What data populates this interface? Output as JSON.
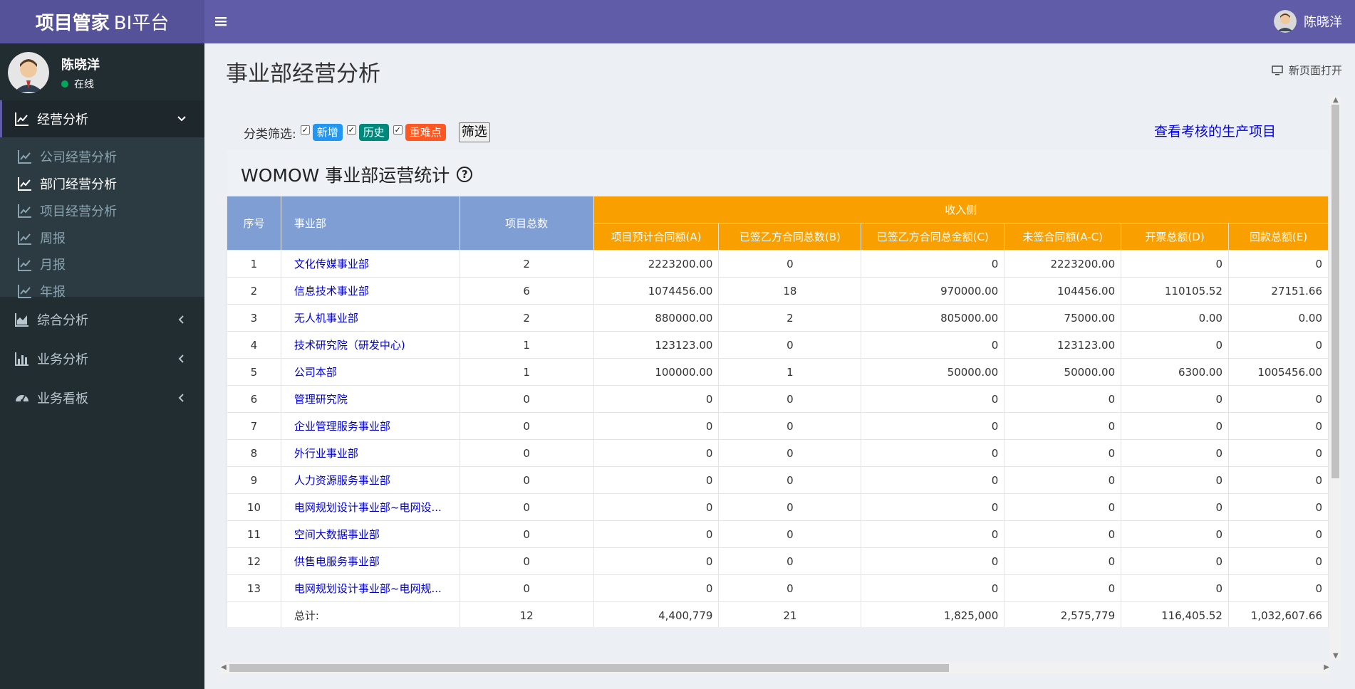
{
  "app": {
    "brand_bold": "项目管家",
    "brand_rest": "BI平台",
    "user": "陈晓洋"
  },
  "sidebar": {
    "user_name": "陈晓洋",
    "status": "在线",
    "groups": [
      {
        "label": "经营分析"
      },
      {
        "label": "综合分析"
      },
      {
        "label": "业务分析"
      },
      {
        "label": "业务看板"
      }
    ],
    "subitems": [
      {
        "label": "公司经营分析"
      },
      {
        "label": "部门经营分析"
      },
      {
        "label": "项目经营分析"
      },
      {
        "label": "周报"
      },
      {
        "label": "月报"
      },
      {
        "label": "年报"
      }
    ]
  },
  "page": {
    "title": "事业部经营分析",
    "new_page": "新页面打开"
  },
  "filter": {
    "label": "分类筛选:",
    "tags": [
      "新增",
      "历史",
      "重难点"
    ],
    "button": "筛选",
    "link": "查看考核的生产项目"
  },
  "panel": {
    "title": "WOMOW 事业部运营统计",
    "help": "?"
  },
  "table": {
    "headers": {
      "seq": "序号",
      "dept": "事业部",
      "total": "项目总数",
      "income": "收入侧",
      "sub": [
        "项目预计合同额(A)",
        "已签乙方合同总数(B)",
        "已签乙方合同总金额(C)",
        "未签合同额(A-C)",
        "开票总额(D)",
        "回款总额(E)"
      ]
    },
    "rows": [
      {
        "seq": "1",
        "dept": "文化传媒事业部",
        "total": "2",
        "a": "2223200.00",
        "b": "0",
        "c": "0",
        "ac": "2223200.00",
        "d": "0",
        "e": "0"
      },
      {
        "seq": "2",
        "dept": "信息技术事业部",
        "total": "6",
        "a": "1074456.00",
        "b": "18",
        "c": "970000.00",
        "ac": "104456.00",
        "d": "110105.52",
        "e": "27151.66"
      },
      {
        "seq": "3",
        "dept": "无人机事业部",
        "total": "2",
        "a": "880000.00",
        "b": "2",
        "c": "805000.00",
        "ac": "75000.00",
        "d": "0.00",
        "e": "0.00"
      },
      {
        "seq": "4",
        "dept": "技术研究院（研发中心)",
        "total": "1",
        "a": "123123.00",
        "b": "0",
        "c": "0",
        "ac": "123123.00",
        "d": "0",
        "e": "0"
      },
      {
        "seq": "5",
        "dept": "公司本部",
        "total": "1",
        "a": "100000.00",
        "b": "1",
        "c": "50000.00",
        "ac": "50000.00",
        "d": "6300.00",
        "e": "1005456.00"
      },
      {
        "seq": "6",
        "dept": "管理研究院",
        "total": "0",
        "a": "0",
        "b": "0",
        "c": "0",
        "ac": "0",
        "d": "0",
        "e": "0"
      },
      {
        "seq": "7",
        "dept": "企业管理服务事业部",
        "total": "0",
        "a": "0",
        "b": "0",
        "c": "0",
        "ac": "0",
        "d": "0",
        "e": "0"
      },
      {
        "seq": "8",
        "dept": "外行业事业部",
        "total": "0",
        "a": "0",
        "b": "0",
        "c": "0",
        "ac": "0",
        "d": "0",
        "e": "0"
      },
      {
        "seq": "9",
        "dept": "人力资源服务事业部",
        "total": "0",
        "a": "0",
        "b": "0",
        "c": "0",
        "ac": "0",
        "d": "0",
        "e": "0"
      },
      {
        "seq": "10",
        "dept": "电网规划设计事业部~电网设...",
        "total": "0",
        "a": "0",
        "b": "0",
        "c": "0",
        "ac": "0",
        "d": "0",
        "e": "0"
      },
      {
        "seq": "11",
        "dept": "空间大数据事业部",
        "total": "0",
        "a": "0",
        "b": "0",
        "c": "0",
        "ac": "0",
        "d": "0",
        "e": "0"
      },
      {
        "seq": "12",
        "dept": "供售电服务事业部",
        "total": "0",
        "a": "0",
        "b": "0",
        "c": "0",
        "ac": "0",
        "d": "0",
        "e": "0"
      },
      {
        "seq": "13",
        "dept": "电网规划设计事业部~电网规...",
        "total": "0",
        "a": "0",
        "b": "0",
        "c": "0",
        "ac": "0",
        "d": "0",
        "e": "0"
      }
    ],
    "totals": {
      "label": "总计:",
      "total": "12",
      "a": "4,400,779",
      "b": "21",
      "c": "1,825,000",
      "ac": "2,575,779",
      "d": "116,405.52",
      "e": "1,032,607.66"
    }
  }
}
